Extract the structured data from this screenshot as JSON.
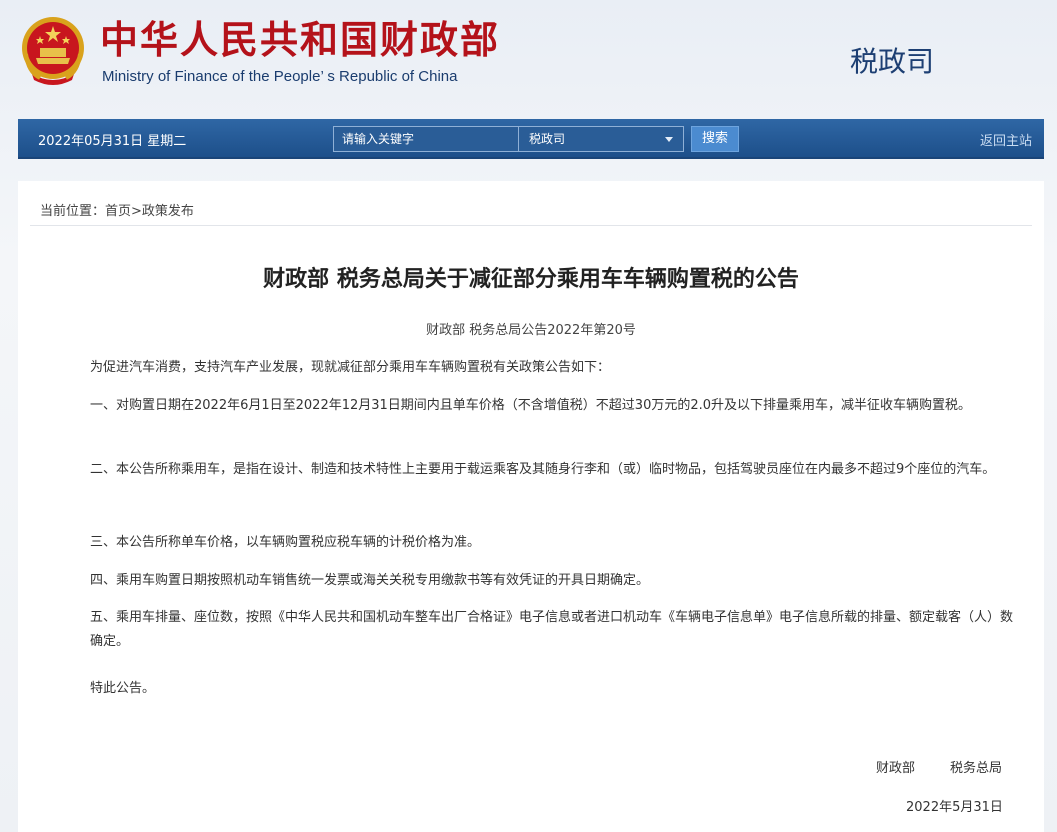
{
  "header": {
    "site_name_cn": "中华人民共和国财政部",
    "site_name_en": "Ministry of Finance of the People’ s Republic of China",
    "department": "税政司"
  },
  "nav": {
    "date": "2022年05月31日  星期二",
    "search_placeholder": "请输入关键字",
    "select_value": "税政司",
    "search_button": "搜索",
    "home_link": "返回主站"
  },
  "breadcrumb": "当前位置：首页>政策发布",
  "article": {
    "title": "财政部 税务总局关于减征部分乘用车车辆购置税的公告",
    "doc_number": "财政部 税务总局公告2022年第20号",
    "intro": "为促进汽车消费，支持汽车产业发展，现就减征部分乘用车车辆购置税有关政策公告如下：",
    "p1": "一、对购置日期在2022年6月1日至2022年12月31日期间内且单车价格（不含增值税）不超过30万元的2.0升及以下排量乘用车，减半征收车辆购置税。",
    "p2": "二、本公告所称乘用车，是指在设计、制造和技术特性上主要用于载运乘客及其随身行李和（或）临时物品，包括驾驶员座位在内最多不超过9个座位的汽车。",
    "p3": "三、本公告所称单车价格，以车辆购置税应税车辆的计税价格为准。",
    "p4": "四、乘用车购置日期按照机动车销售统一发票或海关关税专用缴款书等有效凭证的开具日期确定。",
    "p5": "五、乘用车排量、座位数，按照《中华人民共和国机动车整车出厂合格证》电子信息或者进口机动车《车辆电子信息单》电子信息所载的排量、额定载客（人）数确定。",
    "closing": "特此公告。",
    "signatory_1": "财政部",
    "signatory_2": "税务总局",
    "date": "2022年5月31日"
  },
  "colors": {
    "brand_red": "#b4121a",
    "nav_blue": "#1d4f8a",
    "dept_blue": "#1d3f73"
  },
  "icons": {
    "emblem": "national-emblem-icon",
    "dropdown": "chevron-down-icon"
  }
}
